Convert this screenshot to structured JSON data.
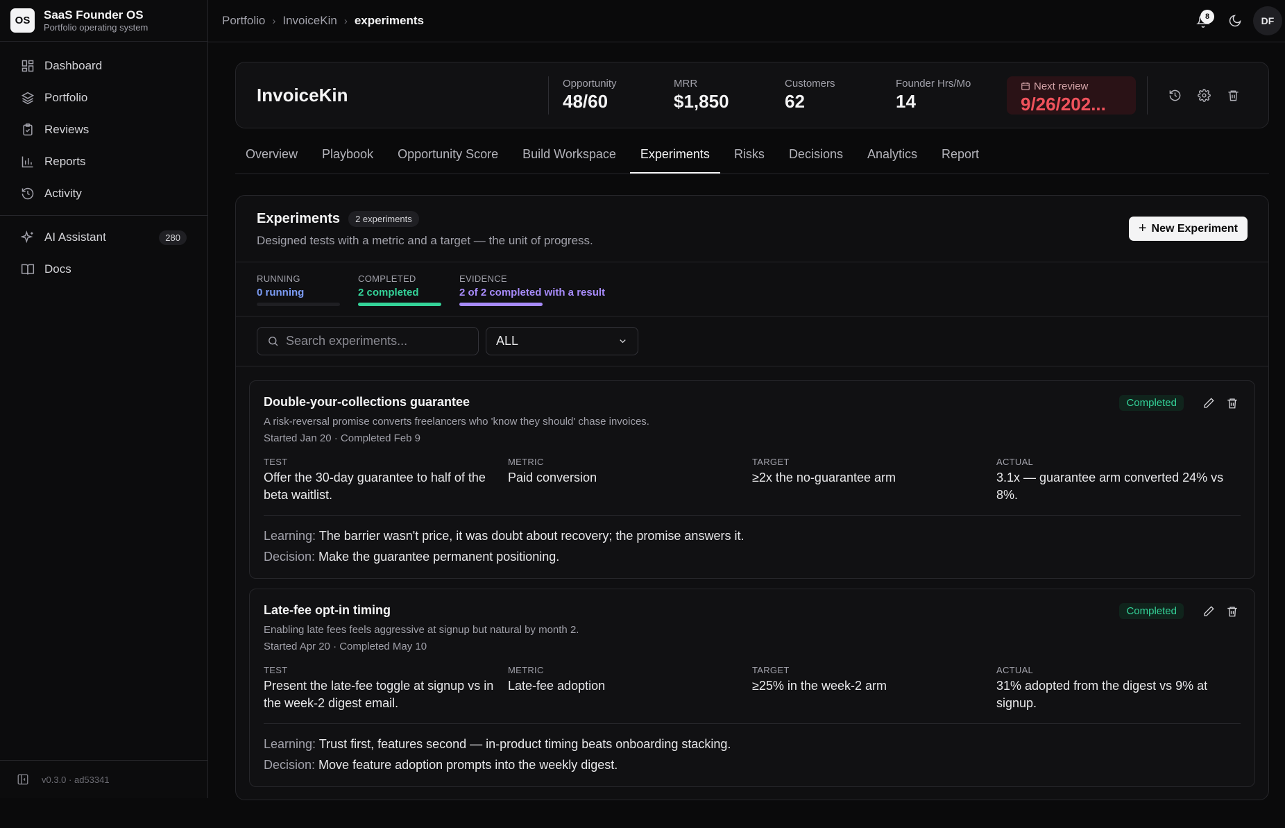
{
  "brand": {
    "logo": "OS",
    "title": "SaaS Founder OS",
    "subtitle": "Portfolio operating system"
  },
  "sidebar": {
    "items": [
      {
        "label": "Dashboard",
        "icon": "dashboard-icon"
      },
      {
        "label": "Portfolio",
        "icon": "layers-icon"
      },
      {
        "label": "Reviews",
        "icon": "clipboard-check-icon"
      },
      {
        "label": "Reports",
        "icon": "bar-chart-icon"
      },
      {
        "label": "Activity",
        "icon": "history-icon"
      }
    ],
    "secondary": [
      {
        "label": "AI Assistant",
        "icon": "sparkles-icon",
        "count": "280"
      },
      {
        "label": "Docs",
        "icon": "book-icon"
      }
    ],
    "footer": "v0.3.0 · ad53341"
  },
  "breadcrumb": [
    "Portfolio",
    "InvoiceKin",
    "experiments"
  ],
  "notifications": "8",
  "user_initials": "DF",
  "product": {
    "name": "InvoiceKin",
    "stats": [
      {
        "label": "Opportunity",
        "value": "48/60"
      },
      {
        "label": "MRR",
        "value": "$1,850"
      },
      {
        "label": "Customers",
        "value": "62"
      },
      {
        "label": "Founder Hrs/Mo",
        "value": "14"
      }
    ],
    "review": {
      "label": "Next review",
      "value": "9/26/202..."
    }
  },
  "tabs": [
    "Overview",
    "Playbook",
    "Opportunity Score",
    "Build Workspace",
    "Experiments",
    "Risks",
    "Decisions",
    "Analytics",
    "Report"
  ],
  "active_tab": 4,
  "panel": {
    "title": "Experiments",
    "count": "2 experiments",
    "description": "Designed tests with a metric and a target — the unit of progress.",
    "new_button": "New Experiment"
  },
  "metrics": [
    {
      "label": "RUNNING",
      "value": "0 running",
      "color": "#7c9cf5",
      "fill": 0.0
    },
    {
      "label": "COMPLETED",
      "value": "2 completed",
      "color": "#34d399",
      "fill": 1.0
    },
    {
      "label": "EVIDENCE",
      "value": "2 of 2 completed with a result",
      "color": "#a78bfa",
      "fill": 1.0
    }
  ],
  "search": {
    "placeholder": "Search experiments..."
  },
  "filter": {
    "value": "ALL"
  },
  "columns": {
    "test": "TEST",
    "metric": "METRIC",
    "target": "TARGET",
    "actual": "ACTUAL"
  },
  "note_labels": {
    "learning": "Learning:",
    "decision": "Decision:"
  },
  "experiments": [
    {
      "title": "Double-your-collections guarantee",
      "description": "A risk-reversal promise converts freelancers who 'know they should' chase invoices.",
      "dates": "Started Jan 20 · Completed Feb 9",
      "status": "Completed",
      "test": "Offer the 30-day guarantee to half of the beta waitlist.",
      "metric": "Paid conversion",
      "target": "≥2x the no-guarantee arm",
      "actual": "3.1x — guarantee arm converted 24% vs 8%.",
      "learning": "The barrier wasn't price, it was doubt about recovery; the promise answers it.",
      "decision": "Make the guarantee permanent positioning."
    },
    {
      "title": "Late-fee opt-in timing",
      "description": "Enabling late fees feels aggressive at signup but natural by month 2.",
      "dates": "Started Apr 20 · Completed May 10",
      "status": "Completed",
      "test": "Present the late-fee toggle at signup vs in the week-2 digest email.",
      "metric": "Late-fee adoption",
      "target": "≥25% in the week-2 arm",
      "actual": "31% adopted from the digest vs 9% at signup.",
      "learning": "Trust first, features second — in-product timing beats onboarding stacking.",
      "decision": "Move feature adoption prompts into the weekly digest."
    }
  ]
}
